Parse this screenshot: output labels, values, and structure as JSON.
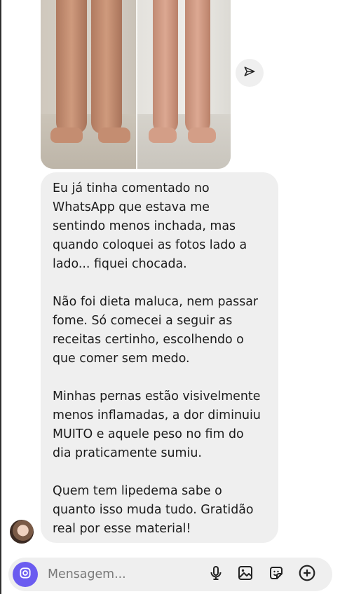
{
  "chat": {
    "message_paragraphs": [
      "Eu já tinha comentado no\nWhatsApp que estava me\nsentindo menos inchada, mas\nquando coloquei as fotos lado a\nlado... fiquei chocada.",
      "Não foi dieta maluca, nem passar\nfome. Só comecei a seguir as\nreceitas certinho, escolhendo o\nque comer sem medo.",
      "Minhas pernas estão visivelmente\nmenos inflamadas, a dor diminuiu\nMUITO e aquele peso no fim do\ndia praticamente sumiu.",
      "Quem tem lipedema sabe o\nquanto isso muda tudo. Gratidão\nreal por esse material!"
    ]
  },
  "composer": {
    "placeholder": "Mensagem..."
  },
  "icons": {
    "share": "paper-plane-icon",
    "camera": "camera-icon",
    "mic": "microphone-icon",
    "gallery": "image-icon",
    "sticker": "sticker-icon",
    "more": "plus-circle-icon"
  },
  "colors": {
    "bubble_bg": "#efefef",
    "accent": "#6b5cf0"
  }
}
